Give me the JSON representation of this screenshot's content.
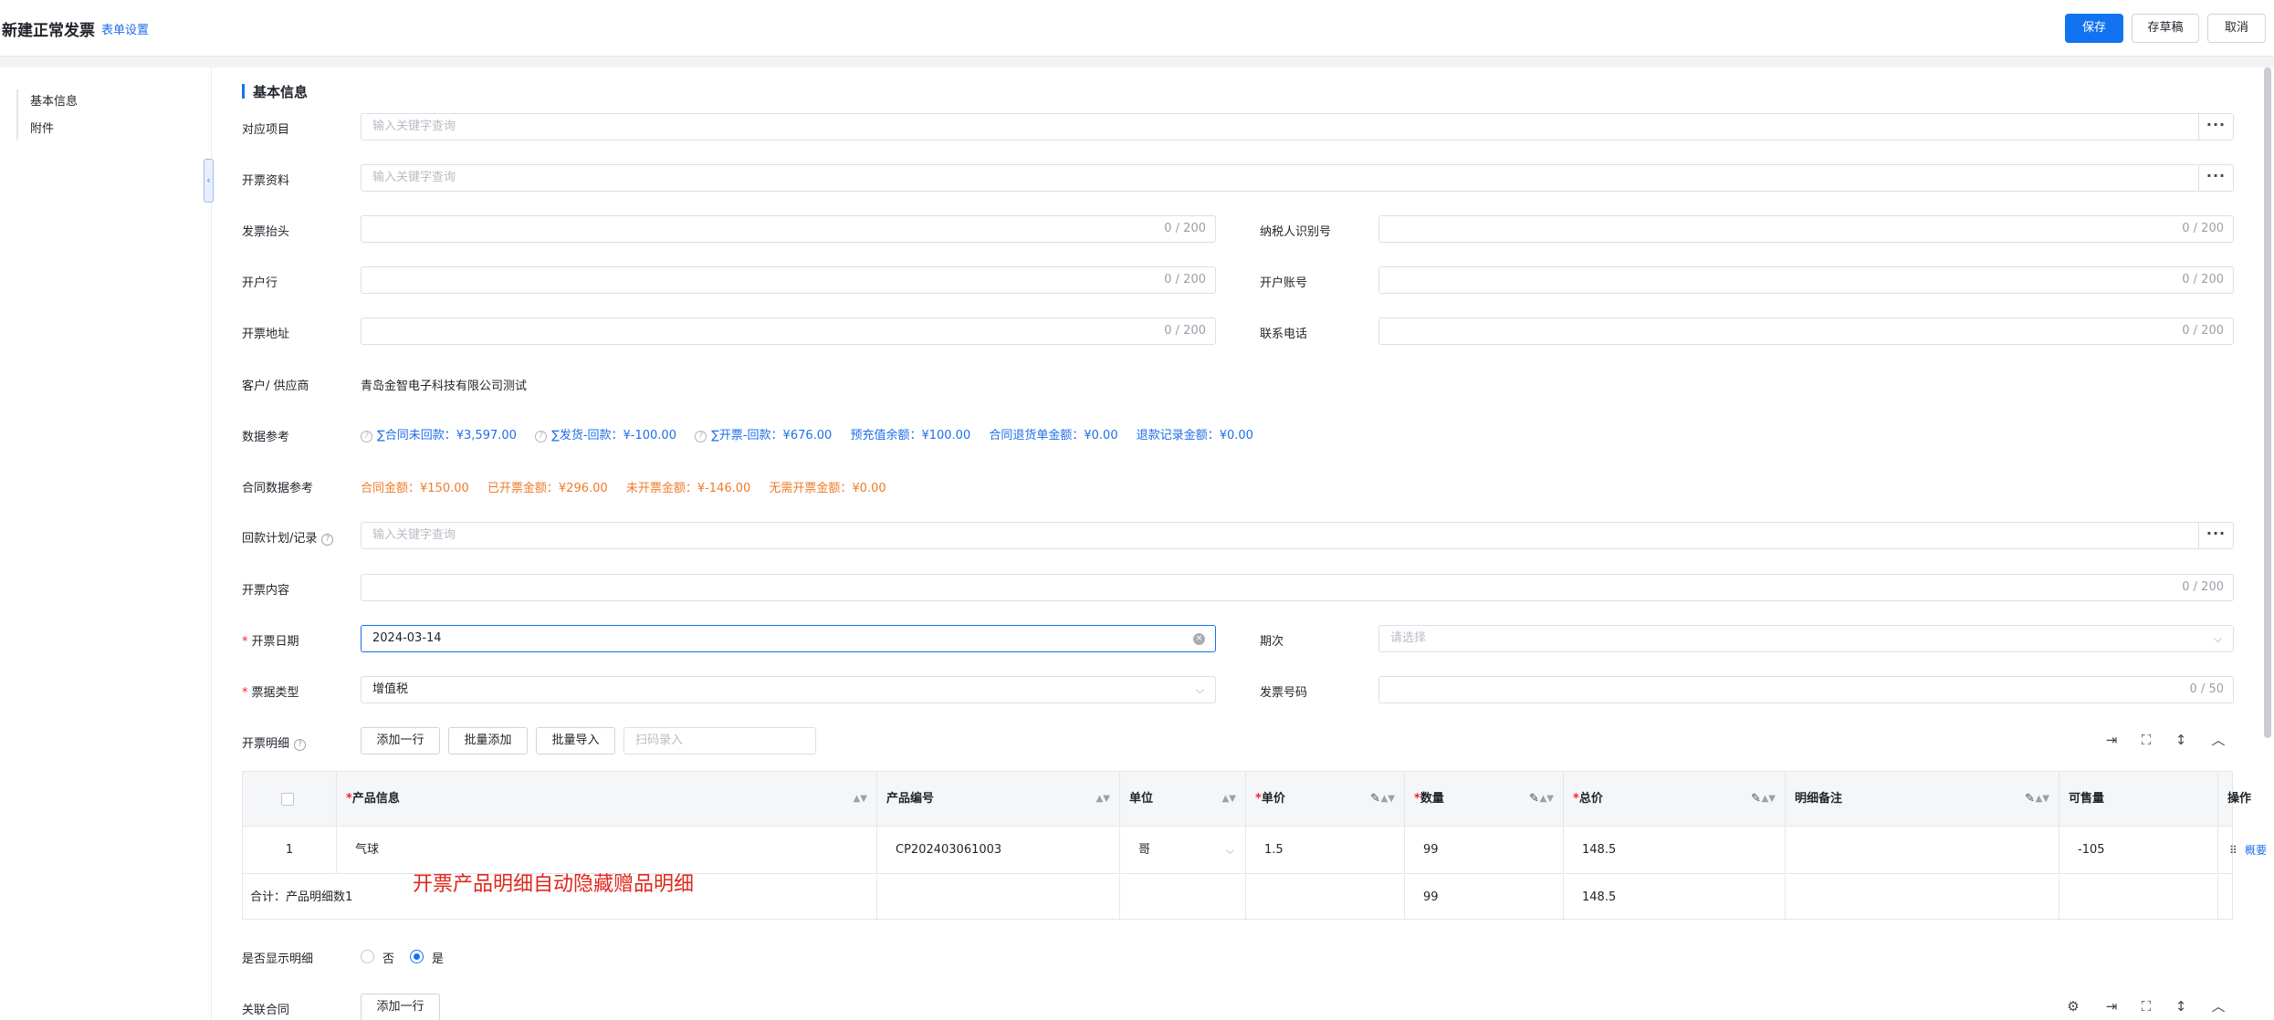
{
  "header": {
    "title": "新建正常发票",
    "form_setting": "表单设置",
    "save": "保存",
    "draft": "存草稿",
    "cancel": "取消"
  },
  "nav": {
    "items": [
      "基本信息",
      "附件"
    ]
  },
  "section": {
    "title": "基本信息"
  },
  "fields": {
    "project": {
      "label": "对应项目",
      "placeholder": "输入关键字查询"
    },
    "billing_info": {
      "label": "开票资料",
      "placeholder": "输入关键字查询"
    },
    "invoice_title": {
      "label": "发票抬头",
      "count": "0 / 200"
    },
    "taxpayer_id": {
      "label": "纳税人识别号",
      "count": "0 / 200"
    },
    "bank": {
      "label": "开户行",
      "count": "0 / 200"
    },
    "account": {
      "label": "开户账号",
      "count": "0 / 200"
    },
    "address": {
      "label": "开票地址",
      "count": "0 / 200"
    },
    "phone": {
      "label": "联系电话",
      "count": "0 / 200"
    },
    "customer": {
      "label": "客户/ 供应商",
      "value": "青岛金智电子科技有限公司测试"
    },
    "data_ref": {
      "label": "数据参考",
      "items": [
        "∑合同未回款：¥3,597.00",
        "∑发货-回款：¥-100.00",
        "∑开票-回款：¥676.00",
        "预充值余额：¥100.00",
        "合同退货单金额：¥0.00",
        "退款记录金额：¥0.00"
      ]
    },
    "contract_ref": {
      "label": "合同数据参考",
      "items": [
        "合同金额：¥150.00",
        "已开票金额：¥296.00",
        "未开票金额：¥-146.00",
        "无需开票金额：¥0.00"
      ]
    },
    "payment_plan": {
      "label": "回款计划/记录",
      "placeholder": "输入关键字查询"
    },
    "content": {
      "label": "开票内容",
      "count": "0 / 200"
    },
    "date": {
      "label": "开票日期",
      "value": "2024-03-14"
    },
    "period": {
      "label": "期次",
      "placeholder": "请选择"
    },
    "ticket_type": {
      "label": "票据类型",
      "value": "增值税"
    },
    "invoice_no": {
      "label": "发票号码",
      "count": "0 / 50"
    },
    "detail": {
      "label": "开票明细",
      "add_row": "添加一行",
      "batch_add": "批量添加",
      "batch_import": "批量导入",
      "scan_placeholder": "扫码录入"
    },
    "show_detail": {
      "label": "是否显示明细",
      "no": "否",
      "yes": "是",
      "selected": "是"
    },
    "related_contract": {
      "label": "关联合同",
      "add_row": "添加一行"
    }
  },
  "table": {
    "columns": [
      "产品信息",
      "产品编号",
      "单位",
      "单价",
      "数量",
      "总价",
      "明细备注",
      "可售量",
      "操作"
    ],
    "rows": [
      {
        "index": "1",
        "product": "气球",
        "code": "CP202403061003",
        "unit": "哥",
        "price": "1.5",
        "qty": "99",
        "total": "148.5",
        "remark": "",
        "stock": "-105",
        "action": "概要"
      }
    ],
    "summary": {
      "label": "合计：产品明细数1",
      "qty": "99",
      "total": "148.5"
    }
  },
  "annotation": "开票产品明细自动隐藏赠品明细",
  "colors": {
    "primary": "#1273f0",
    "link": "#1e6fe8",
    "orange": "#f07a28",
    "required": "#f5222d",
    "annotation": "#e0271c"
  }
}
